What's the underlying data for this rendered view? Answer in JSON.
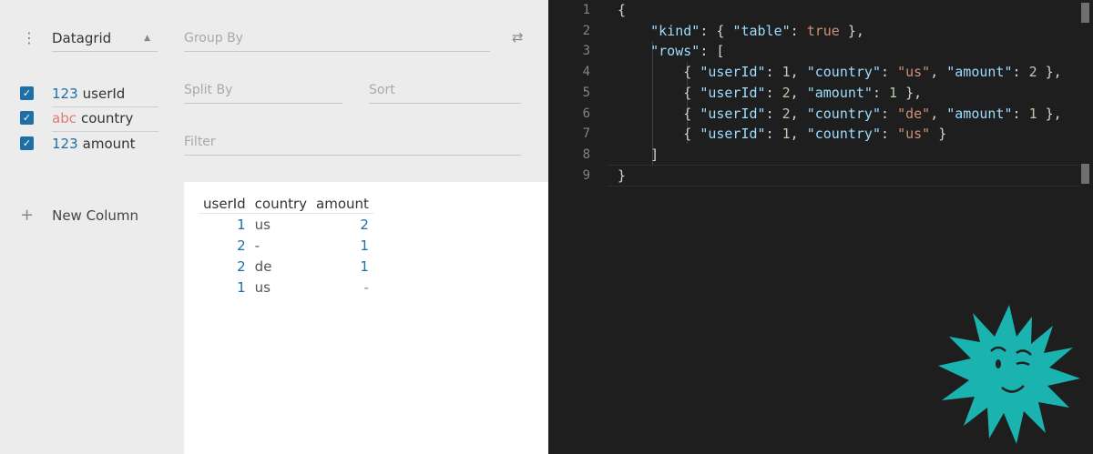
{
  "left": {
    "plugin_label": "Datagrid",
    "group_by_placeholder": "Group By",
    "split_by_placeholder": "Split By",
    "sort_placeholder": "Sort",
    "filter_placeholder": "Filter",
    "columns": [
      {
        "type": "123",
        "name": "userId"
      },
      {
        "type": "abc",
        "name": "country"
      },
      {
        "type": "123",
        "name": "amount"
      }
    ],
    "new_column_label": "New Column",
    "grid": {
      "headers": [
        "userId",
        "country",
        "amount"
      ],
      "rows": [
        [
          "1",
          "us",
          "2"
        ],
        [
          "2",
          "-",
          "1"
        ],
        [
          "2",
          "de",
          "1"
        ],
        [
          "1",
          "us",
          "-"
        ]
      ]
    }
  },
  "editor": {
    "line_numbers": [
      "1",
      "2",
      "3",
      "4",
      "5",
      "6",
      "7",
      "8",
      "9"
    ]
  },
  "colors": {
    "accent": "#1d6fa5",
    "string_type": "#e07b6f",
    "editor_bg": "#1e1e1e",
    "mascot": "#1ab3b0"
  }
}
